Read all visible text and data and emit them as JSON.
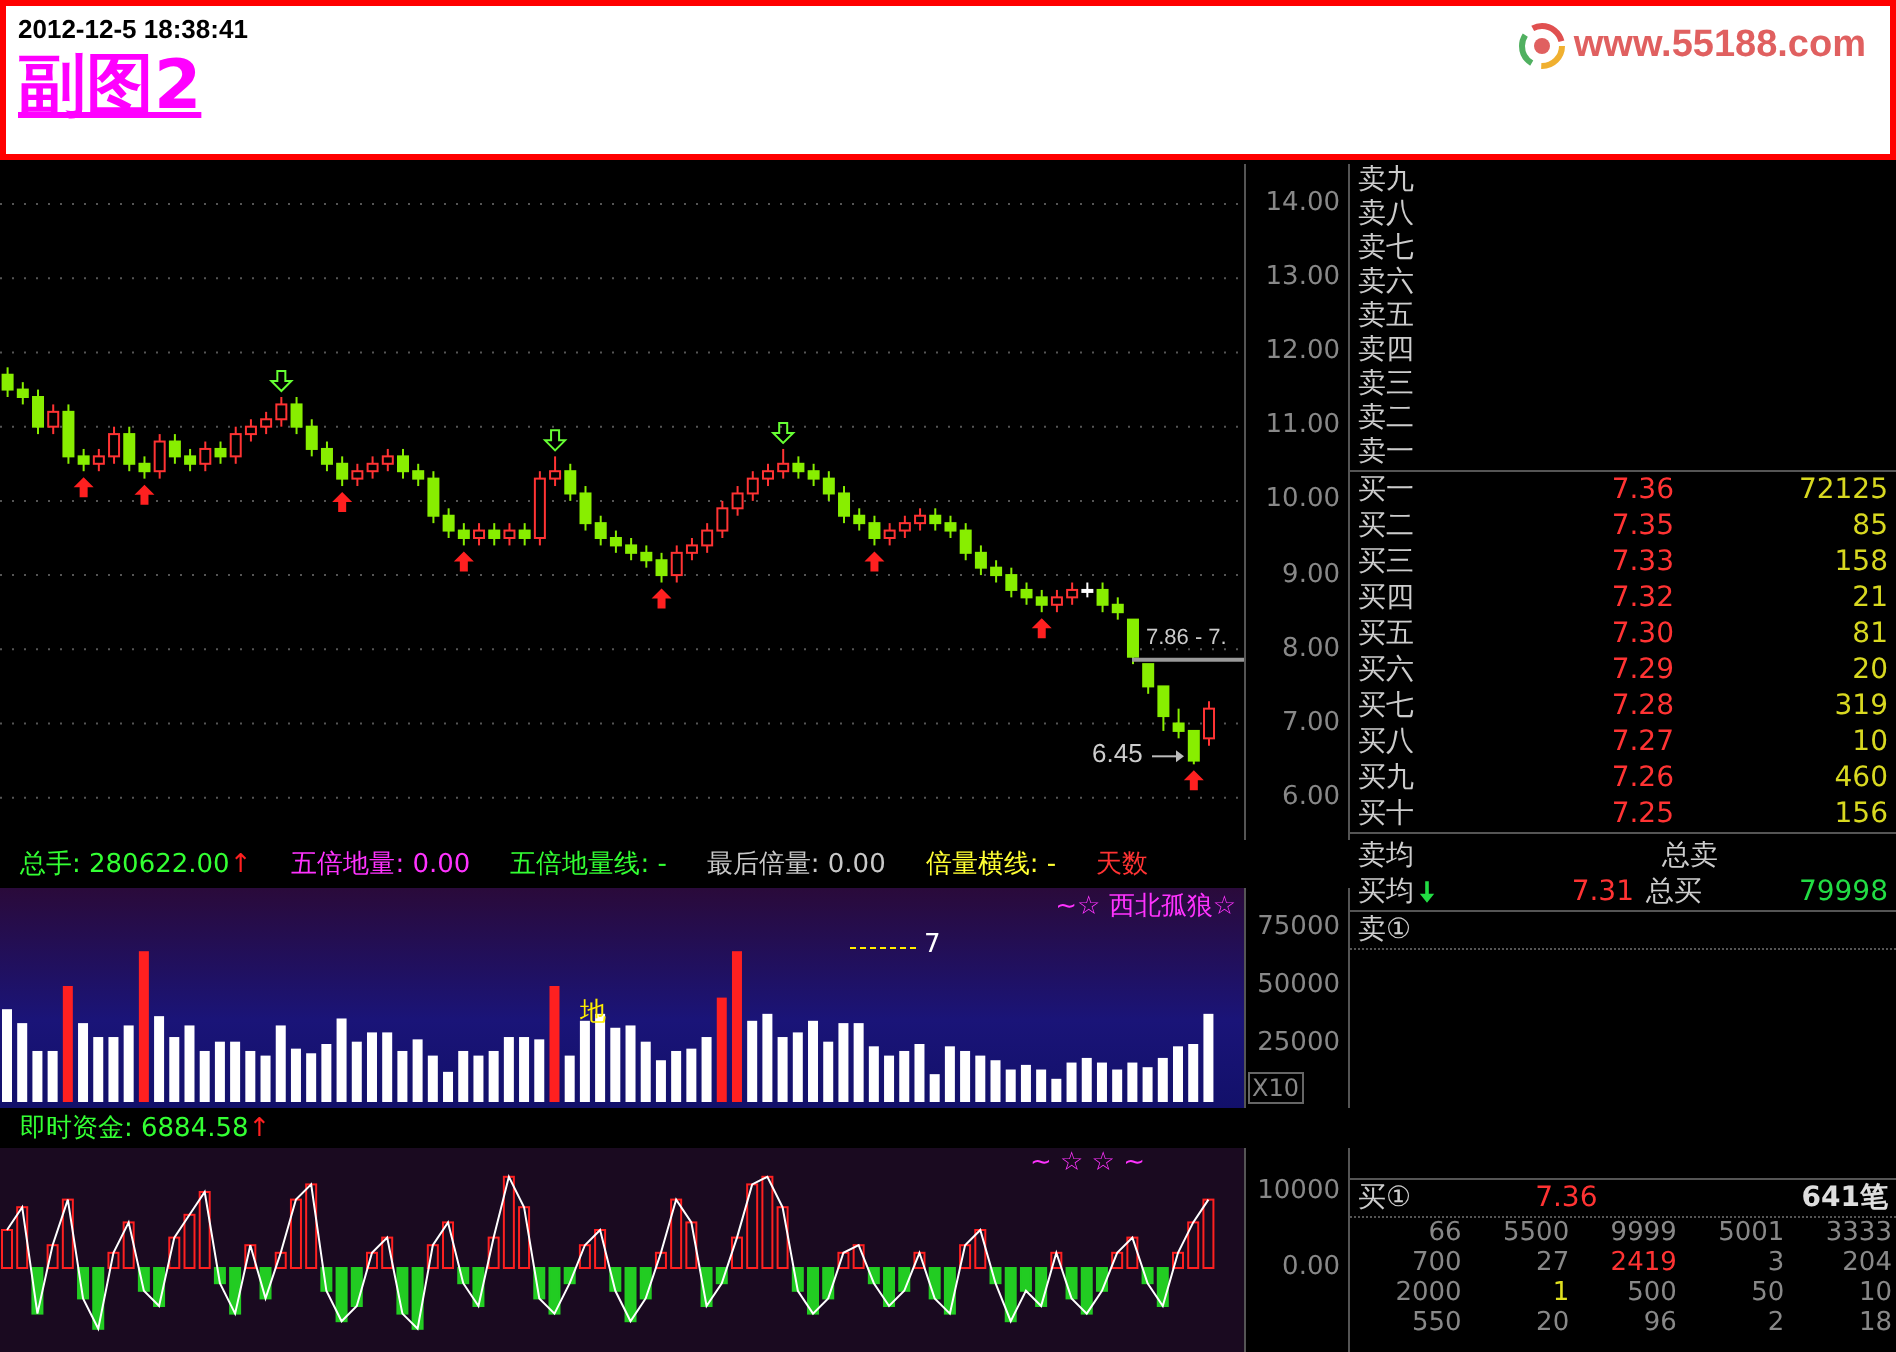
{
  "header": {
    "timestamp": "2012-12-5 18:38:41",
    "title": "副图2",
    "site": "www.55188.com"
  },
  "price_chart": {
    "high_label": "7.86 - 7.",
    "low_label": "6.45",
    "chart_data": {
      "type": "candlestick",
      "yticks": [
        {
          "value": 14,
          "label": "14.00"
        },
        {
          "value": 13,
          "label": "13.00"
        },
        {
          "value": 12,
          "label": "12.00"
        },
        {
          "value": 11,
          "label": "11.00"
        },
        {
          "value": 10,
          "label": "10.00"
        },
        {
          "value": 9,
          "label": "9.00"
        },
        {
          "value": 8,
          "label": "8.00"
        },
        {
          "value": 7,
          "label": "7.00"
        },
        {
          "value": 6,
          "label": "6.00"
        }
      ],
      "ylim": [
        5.43,
        14.54
      ],
      "grid": true,
      "categories": [
        null,
        null,
        null,
        null,
        null,
        null,
        null,
        null,
        null,
        null,
        null,
        null,
        null,
        null,
        null,
        null,
        null,
        null,
        null,
        null,
        null,
        null,
        null,
        null,
        null,
        null,
        null,
        null,
        null,
        null,
        null,
        null,
        null,
        null,
        null,
        null,
        null,
        null,
        null,
        null,
        null,
        null,
        null,
        null,
        null,
        null,
        null,
        null,
        null,
        null,
        null,
        null,
        null,
        null,
        null,
        null,
        null,
        null,
        null,
        null,
        null,
        null,
        null,
        null,
        null,
        null,
        null,
        null,
        null,
        null,
        null,
        null,
        null,
        null,
        null,
        null,
        null,
        null,
        null,
        null
      ],
      "ohlc": [
        [
          11.7,
          11.8,
          11.4,
          11.5
        ],
        [
          11.5,
          11.6,
          11.3,
          11.4
        ],
        [
          11.4,
          11.5,
          10.9,
          11.0
        ],
        [
          11.0,
          11.3,
          10.9,
          11.2
        ],
        [
          11.2,
          11.3,
          10.5,
          10.6
        ],
        [
          10.6,
          10.7,
          10.4,
          10.5
        ],
        [
          10.5,
          10.7,
          10.4,
          10.6
        ],
        [
          10.6,
          11.0,
          10.5,
          10.9
        ],
        [
          10.9,
          11.0,
          10.4,
          10.5
        ],
        [
          10.5,
          10.6,
          10.3,
          10.4
        ],
        [
          10.4,
          10.9,
          10.3,
          10.8
        ],
        [
          10.8,
          10.9,
          10.5,
          10.6
        ],
        [
          10.6,
          10.7,
          10.4,
          10.5
        ],
        [
          10.5,
          10.8,
          10.4,
          10.7
        ],
        [
          10.7,
          10.8,
          10.5,
          10.6
        ],
        [
          10.6,
          11.0,
          10.5,
          10.9
        ],
        [
          10.9,
          11.1,
          10.8,
          11.0
        ],
        [
          11.0,
          11.2,
          10.9,
          11.1
        ],
        [
          11.1,
          11.4,
          11.0,
          11.3
        ],
        [
          11.3,
          11.4,
          10.9,
          11.0
        ],
        [
          11.0,
          11.1,
          10.6,
          10.7
        ],
        [
          10.7,
          10.8,
          10.4,
          10.5
        ],
        [
          10.5,
          10.6,
          10.2,
          10.3
        ],
        [
          10.3,
          10.5,
          10.2,
          10.4
        ],
        [
          10.4,
          10.6,
          10.3,
          10.5
        ],
        [
          10.5,
          10.7,
          10.4,
          10.6
        ],
        [
          10.6,
          10.7,
          10.3,
          10.4
        ],
        [
          10.4,
          10.5,
          10.2,
          10.3
        ],
        [
          10.3,
          10.4,
          9.7,
          9.8
        ],
        [
          9.8,
          9.9,
          9.5,
          9.6
        ],
        [
          9.6,
          9.7,
          9.4,
          9.5
        ],
        [
          9.5,
          9.7,
          9.4,
          9.6
        ],
        [
          9.6,
          9.7,
          9.4,
          9.5
        ],
        [
          9.5,
          9.7,
          9.4,
          9.6
        ],
        [
          9.6,
          9.7,
          9.4,
          9.5
        ],
        [
          9.5,
          10.4,
          9.4,
          10.3
        ],
        [
          10.3,
          10.6,
          10.2,
          10.4
        ],
        [
          10.4,
          10.5,
          10.0,
          10.1
        ],
        [
          10.1,
          10.2,
          9.6,
          9.7
        ],
        [
          9.7,
          9.8,
          9.4,
          9.5
        ],
        [
          9.5,
          9.6,
          9.3,
          9.4
        ],
        [
          9.4,
          9.5,
          9.2,
          9.3
        ],
        [
          9.3,
          9.4,
          9.1,
          9.2
        ],
        [
          9.2,
          9.3,
          8.9,
          9.0
        ],
        [
          9.0,
          9.4,
          8.9,
          9.3
        ],
        [
          9.3,
          9.5,
          9.2,
          9.4
        ],
        [
          9.4,
          9.7,
          9.3,
          9.6
        ],
        [
          9.6,
          10.0,
          9.5,
          9.9
        ],
        [
          9.9,
          10.2,
          9.8,
          10.1
        ],
        [
          10.1,
          10.4,
          10.0,
          10.3
        ],
        [
          10.3,
          10.5,
          10.2,
          10.4
        ],
        [
          10.4,
          10.7,
          10.3,
          10.5
        ],
        [
          10.5,
          10.6,
          10.3,
          10.4
        ],
        [
          10.4,
          10.5,
          10.2,
          10.3
        ],
        [
          10.3,
          10.4,
          10.0,
          10.1
        ],
        [
          10.1,
          10.2,
          9.7,
          9.8
        ],
        [
          9.8,
          9.9,
          9.6,
          9.7
        ],
        [
          9.7,
          9.8,
          9.4,
          9.5
        ],
        [
          9.5,
          9.7,
          9.4,
          9.6
        ],
        [
          9.6,
          9.8,
          9.5,
          9.7
        ],
        [
          9.7,
          9.9,
          9.6,
          9.8
        ],
        [
          9.8,
          9.9,
          9.6,
          9.7
        ],
        [
          9.7,
          9.8,
          9.5,
          9.6
        ],
        [
          9.6,
          9.7,
          9.2,
          9.3
        ],
        [
          9.3,
          9.4,
          9.0,
          9.1
        ],
        [
          9.1,
          9.2,
          8.9,
          9.0
        ],
        [
          9.0,
          9.1,
          8.7,
          8.8
        ],
        [
          8.8,
          8.9,
          8.6,
          8.7
        ],
        [
          8.7,
          8.8,
          8.5,
          8.6
        ],
        [
          8.6,
          8.8,
          8.5,
          8.7
        ],
        [
          8.7,
          8.9,
          8.6,
          8.8
        ],
        [
          8.8,
          8.9,
          8.7,
          8.8
        ],
        [
          8.8,
          8.9,
          8.5,
          8.6
        ],
        [
          8.6,
          8.7,
          8.4,
          8.5
        ],
        [
          8.4,
          8.4,
          7.8,
          7.9
        ],
        [
          7.8,
          7.8,
          7.4,
          7.5
        ],
        [
          7.5,
          7.5,
          6.9,
          7.1
        ],
        [
          7.0,
          7.2,
          6.8,
          6.9
        ],
        [
          6.9,
          6.9,
          6.45,
          6.5
        ],
        [
          6.8,
          7.3,
          6.7,
          7.2
        ]
      ]
    }
  },
  "volume_info": [
    {
      "text": "总手: 280622.00",
      "color": "#33ff33",
      "suffix": "↑"
    },
    {
      "text": "五倍地量: 0.00",
      "color": "#ff33ff"
    },
    {
      "text": "五倍地量线: -",
      "color": "#33ff33"
    },
    {
      "text": "最后倍量: 0.00",
      "color": "#c8c8c8"
    },
    {
      "text": "倍量横线: -",
      "color": "#ffff33"
    },
    {
      "text": "天数",
      "color": "#ff3333"
    }
  ],
  "volume_panel": {
    "caption": "~☆ 西北孤狼☆",
    "scale": "X10",
    "marks": [
      "地",
      "7"
    ],
    "chart_data": {
      "type": "bar",
      "yticks": [
        {
          "value": 75000,
          "label": "75000"
        },
        {
          "value": 50000,
          "label": "50000"
        },
        {
          "value": 25000,
          "label": "25000"
        }
      ],
      "ylim": [
        -2586,
        92241
      ],
      "categories": [
        null,
        null,
        null,
        null,
        null,
        null,
        null,
        null,
        null,
        null,
        null,
        null,
        null,
        null,
        null,
        null,
        null,
        null,
        null,
        null,
        null,
        null,
        null,
        null,
        null,
        null,
        null,
        null,
        null,
        null,
        null,
        null,
        null,
        null,
        null,
        null,
        null,
        null,
        null,
        null,
        null,
        null,
        null,
        null,
        null,
        null,
        null,
        null,
        null,
        null,
        null,
        null,
        null,
        null,
        null,
        null,
        null,
        null,
        null,
        null,
        null,
        null,
        null,
        null,
        null,
        null,
        null,
        null,
        null,
        null,
        null,
        null,
        null,
        null,
        null,
        null,
        null,
        null,
        null,
        null
      ],
      "values": [
        40000,
        34000,
        22000,
        22000,
        50000,
        34000,
        28000,
        28000,
        33000,
        65000,
        37000,
        28000,
        33000,
        22000,
        26000,
        26000,
        22000,
        20000,
        33000,
        23000,
        21000,
        25000,
        36000,
        26000,
        30000,
        30000,
        22000,
        27000,
        20000,
        13000,
        22000,
        20000,
        22000,
        28000,
        28000,
        27000,
        50000,
        20000,
        35000,
        38000,
        32000,
        33000,
        26000,
        18000,
        22000,
        23000,
        28000,
        45000,
        65000,
        35000,
        38000,
        28000,
        30000,
        35000,
        26000,
        34000,
        34000,
        24000,
        20000,
        22000,
        25000,
        12000,
        24000,
        22000,
        20000,
        18000,
        14000,
        16000,
        14000,
        10000,
        17000,
        19000,
        17000,
        14000,
        17000,
        15000,
        19000,
        24000,
        25000,
        38000
      ]
    }
  },
  "fund_info": [
    {
      "text": "即时资金: 6884.58",
      "color": "#33ff33",
      "suffix": "↑"
    }
  ],
  "fund_panel": {
    "caption": "~ ☆ ☆ ~",
    "chart_data": {
      "type": "bar",
      "yticks": [
        {
          "value": 10000,
          "label": "10000"
        },
        {
          "value": 0,
          "label": "0.00"
        }
      ],
      "ylim": [
        -11579,
        15789
      ],
      "categories": [
        null,
        null,
        null,
        null,
        null,
        null,
        null,
        null,
        null,
        null,
        null,
        null,
        null,
        null,
        null,
        null,
        null,
        null,
        null,
        null,
        null,
        null,
        null,
        null,
        null,
        null,
        null,
        null,
        null,
        null,
        null,
        null,
        null,
        null,
        null,
        null,
        null,
        null,
        null,
        null,
        null,
        null,
        null,
        null,
        null,
        null,
        null,
        null,
        null,
        null,
        null,
        null,
        null,
        null,
        null,
        null,
        null,
        null,
        null,
        null,
        null,
        null,
        null,
        null,
        null,
        null,
        null,
        null,
        null,
        null,
        null,
        null,
        null,
        null,
        null,
        null,
        null,
        null,
        null,
        null
      ],
      "values": [
        5000,
        8000,
        -6000,
        3000,
        9000,
        -4000,
        -8000,
        2000,
        6000,
        -3000,
        -5000,
        4000,
        7000,
        10000,
        -2000,
        -6000,
        3000,
        -4000,
        2000,
        9000,
        11000,
        -3000,
        -7000,
        -5000,
        2000,
        4000,
        -6000,
        -8000,
        3000,
        6000,
        -2000,
        -5000,
        4000,
        12000,
        8000,
        -4000,
        -6000,
        -2000,
        3000,
        5000,
        -3000,
        -7000,
        -4000,
        2000,
        9000,
        6000,
        -5000,
        -2000,
        4000,
        11000,
        12000,
        8000,
        -3000,
        -6000,
        -4000,
        2000,
        3000,
        -2000,
        -5000,
        -3000,
        2000,
        -4000,
        -6000,
        3000,
        5000,
        -2000,
        -7000,
        -3000,
        -5000,
        2000,
        -4000,
        -6000,
        -3000,
        2000,
        4000,
        -2000,
        -5000,
        2000,
        6000,
        9000
      ]
    }
  },
  "order_book": {
    "asks": [
      "卖九",
      "卖八",
      "卖七",
      "卖六",
      "卖五",
      "卖四",
      "卖三",
      "卖二",
      "卖一"
    ],
    "bids": [
      {
        "label": "买一",
        "price": "7.36",
        "volume": "72125"
      },
      {
        "label": "买二",
        "price": "7.35",
        "volume": "85"
      },
      {
        "label": "买三",
        "price": "7.33",
        "volume": "158"
      },
      {
        "label": "买四",
        "price": "7.32",
        "volume": "21"
      },
      {
        "label": "买五",
        "price": "7.30",
        "volume": "81"
      },
      {
        "label": "买六",
        "price": "7.29",
        "volume": "20"
      },
      {
        "label": "买七",
        "price": "7.28",
        "volume": "319"
      },
      {
        "label": "买八",
        "price": "7.27",
        "volume": "10"
      },
      {
        "label": "买九",
        "price": "7.26",
        "volume": "460"
      },
      {
        "label": "买十",
        "price": "7.25",
        "volume": "156"
      }
    ],
    "sell_avg": {
      "label": "卖均",
      "total_label": "总卖"
    },
    "buy_avg": {
      "label": "买均",
      "price": "7.31",
      "total_label": "总买",
      "total": "79998"
    },
    "ask1_queue": {
      "label": "卖①"
    },
    "bid1_queue": {
      "label": "买①",
      "price": "7.36",
      "count": "641笔",
      "rows": [
        [
          {
            "v": "66"
          },
          {
            "v": "5500"
          },
          {
            "v": "9999"
          },
          {
            "v": "5001"
          },
          {
            "v": "3333"
          }
        ],
        [
          {
            "v": "700"
          },
          {
            "v": "27"
          },
          {
            "v": "2419",
            "color": "#ff3333"
          },
          {
            "v": "3"
          },
          {
            "v": "204"
          }
        ],
        [
          {
            "v": "2000"
          },
          {
            "v": "1",
            "color": "#e0e020"
          },
          {
            "v": "500"
          },
          {
            "v": "50"
          },
          {
            "v": "10"
          }
        ],
        [
          {
            "v": "550"
          },
          {
            "v": "20"
          },
          {
            "v": "96"
          },
          {
            "v": "2"
          },
          {
            "v": "18"
          }
        ]
      ]
    }
  }
}
